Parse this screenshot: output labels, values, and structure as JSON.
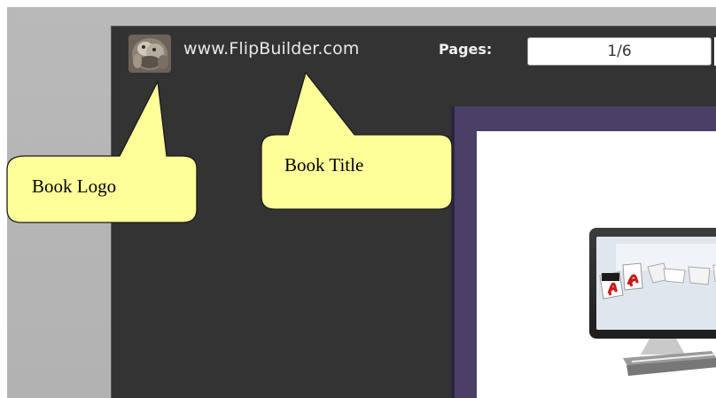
{
  "toolbar": {
    "book_title": "www.FlipBuilder.com",
    "pages_label": "Pages:",
    "page_value": "1/6"
  },
  "callouts": {
    "logo_label": "Book Logo",
    "title_label": "Book Title"
  },
  "screen": {
    "pdf_badge": "PDF"
  },
  "colors": {
    "window_bg": "#333333",
    "book_frame": "#4a3f66",
    "callout_fill": "#ffff99",
    "outer_bg": "#b5b5b5"
  },
  "icons": [
    "book-logo-icon",
    "acrobat-pdf-icon",
    "imac-monitor-icon",
    "book-stack-icon"
  ]
}
